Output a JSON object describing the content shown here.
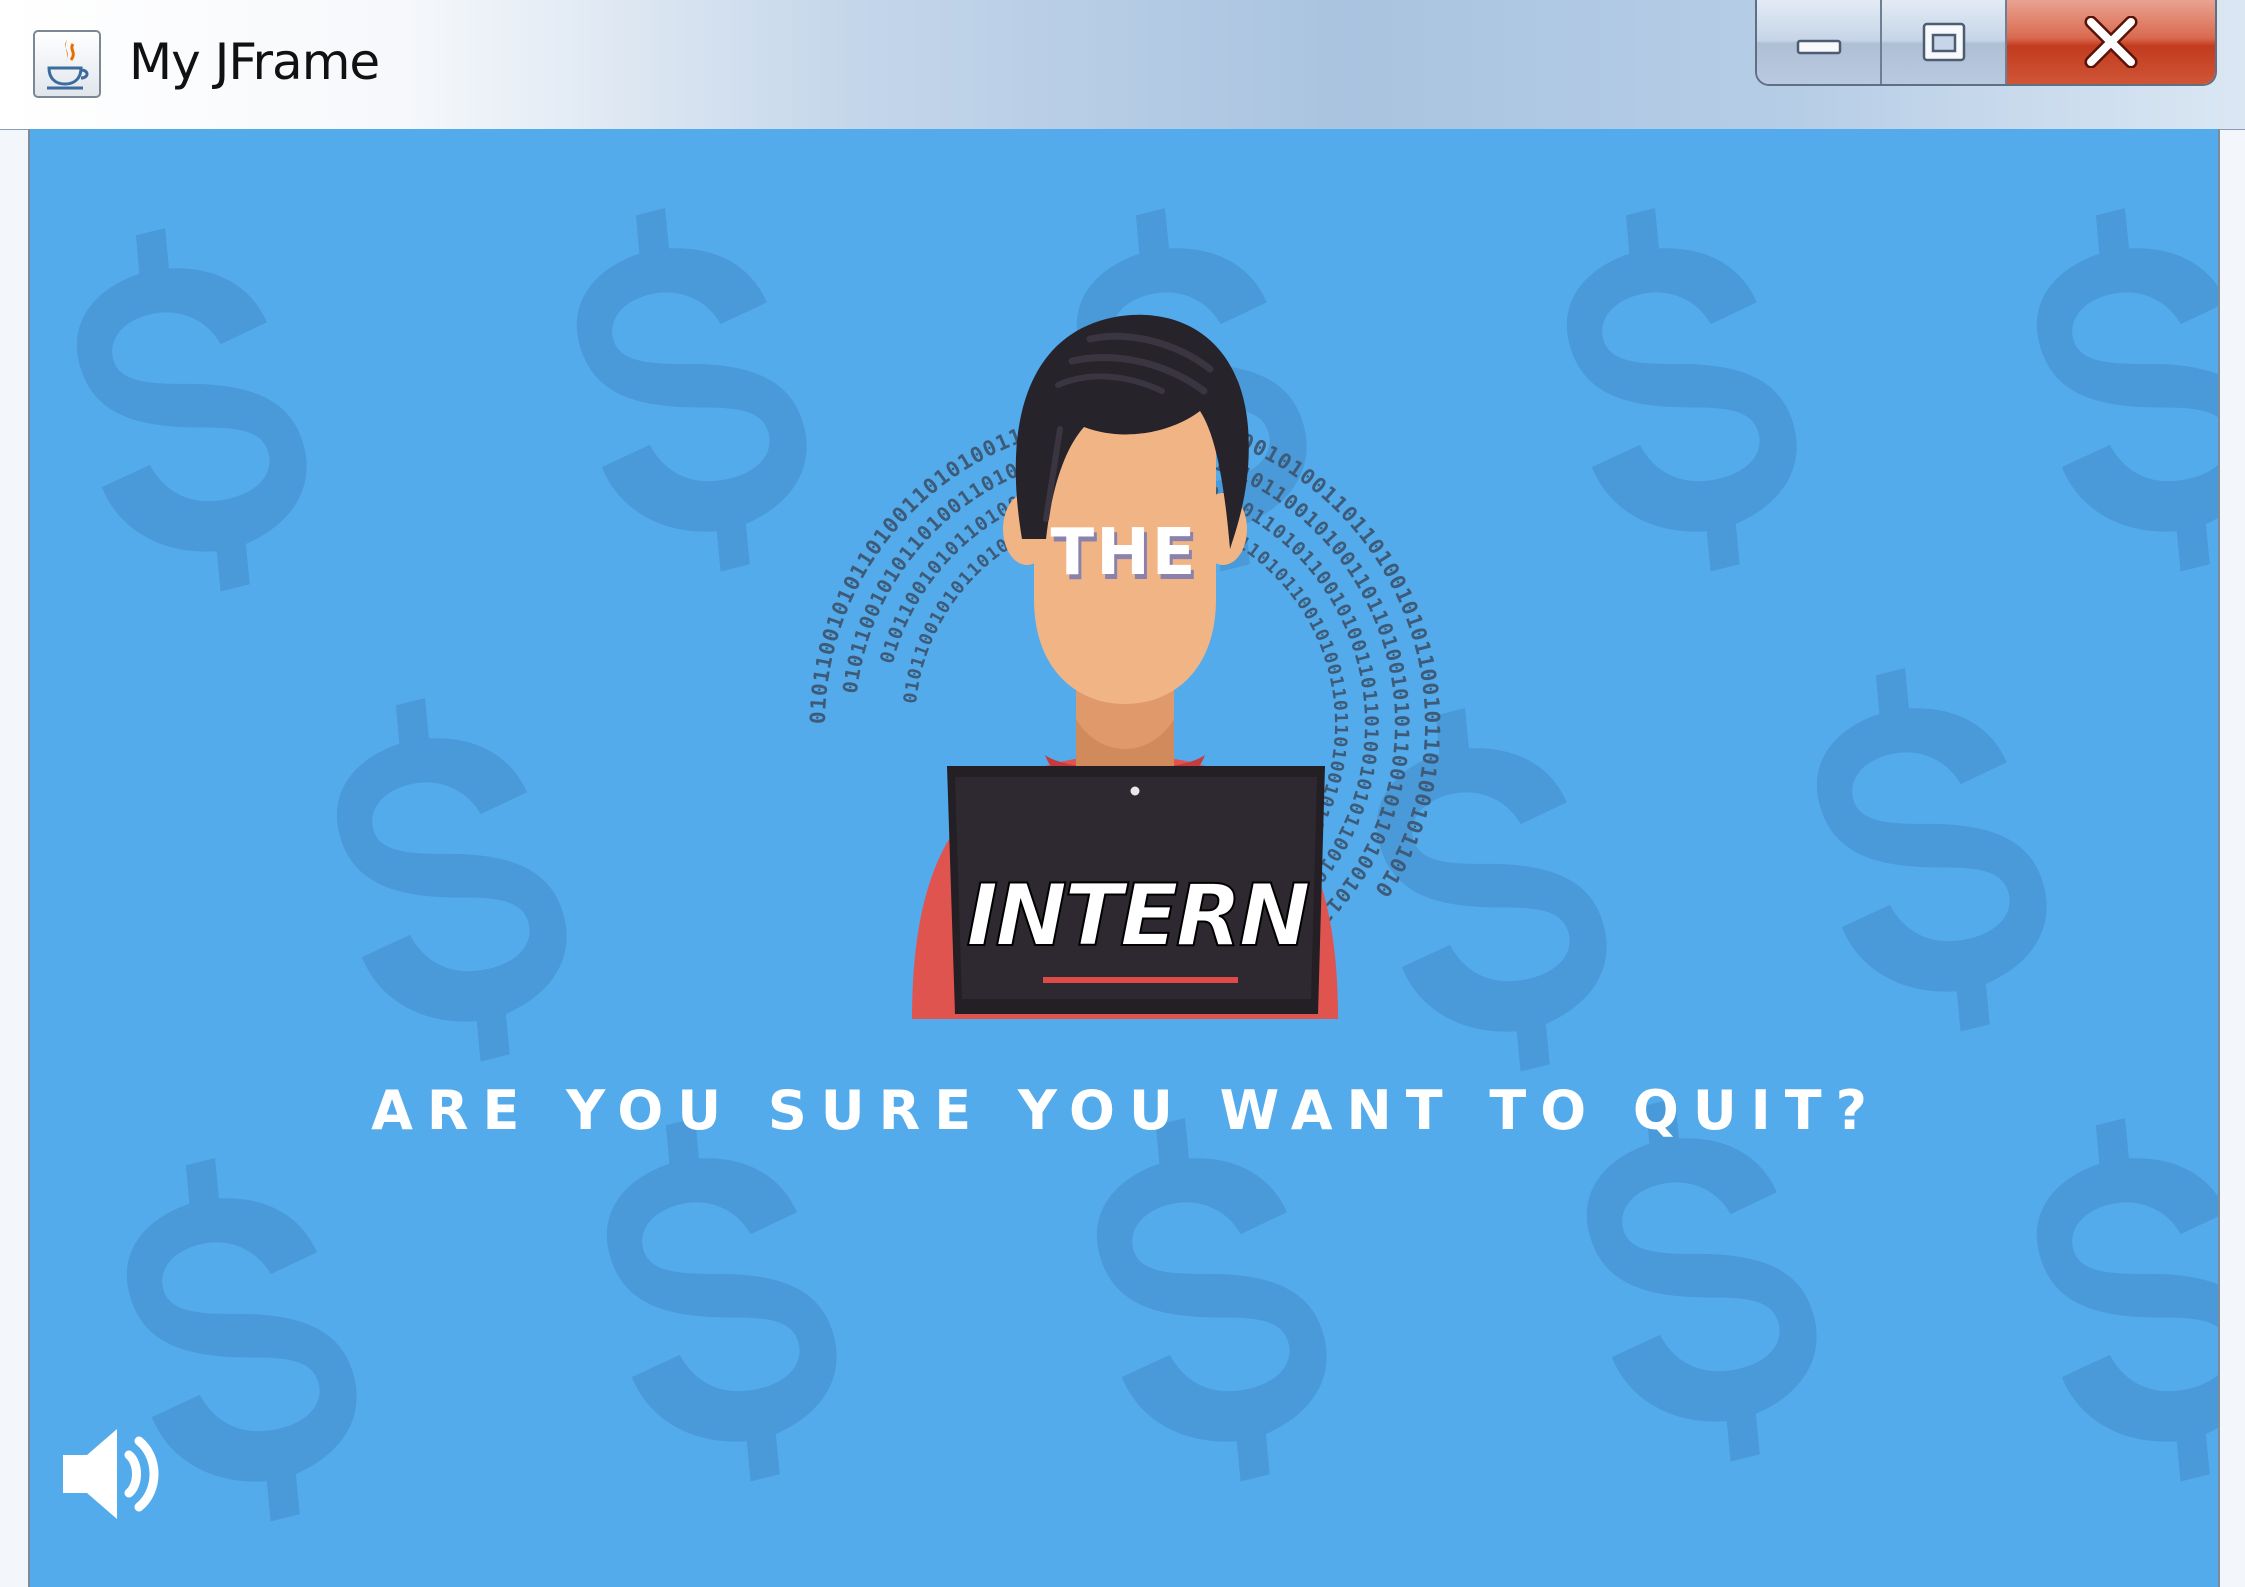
{
  "window": {
    "title": "My JFrame",
    "app_icon": "java-coffee-icon",
    "controls": [
      {
        "icon": "minimize-icon",
        "label": ""
      },
      {
        "icon": "maximize-icon",
        "label": ""
      },
      {
        "icon": "close-icon",
        "label": ""
      }
    ]
  },
  "screen": {
    "logo_top": "THE",
    "logo_bottom": "INTERN",
    "message": "ARE YOU SURE YOU WANT TO QUIT?",
    "sound_icon": "speaker-icon",
    "background_pattern_icon": "dollar-sign-icon",
    "binary_text": "0101100101011010011010100111010101001101011001010011011010010101100101101001011010"
  },
  "colors": {
    "background": "#53abec",
    "pattern": "#4a99d8",
    "shirt": "#e05450",
    "skin": "#f0b485",
    "hair": "#26232a",
    "laptop": "#231f24",
    "accent_red": "#de4a47"
  }
}
